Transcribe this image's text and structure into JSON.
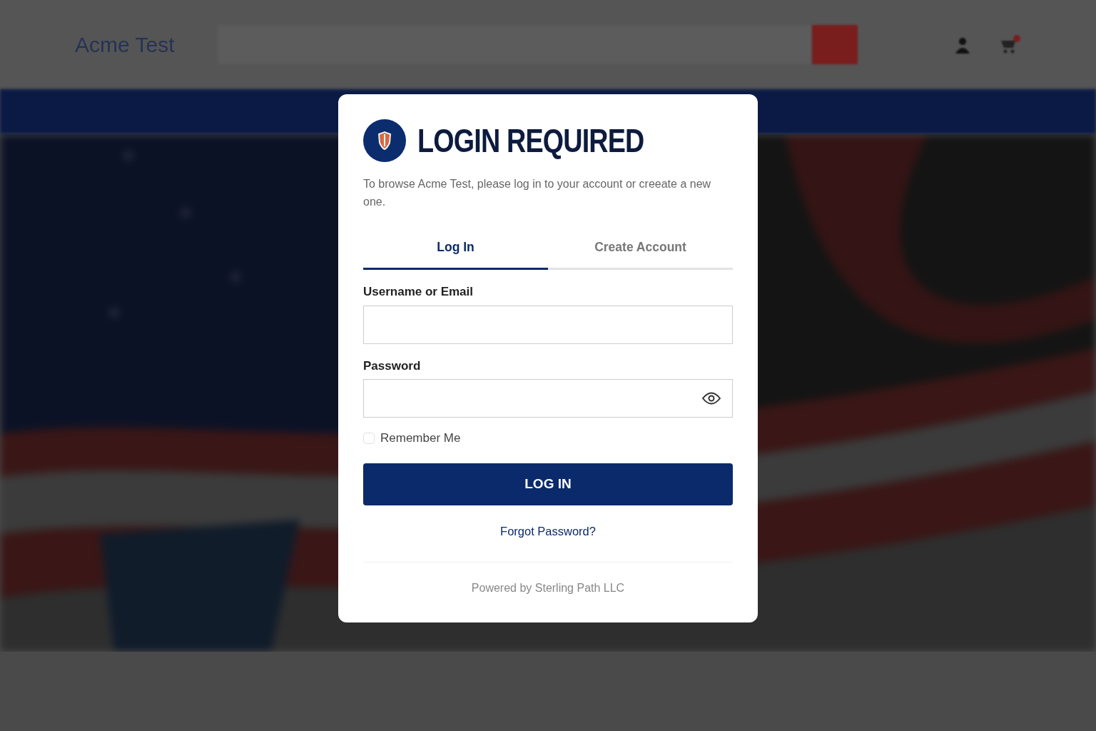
{
  "background": {
    "logo": "Acme Test"
  },
  "dialog": {
    "title": "LOGIN REQUIRED",
    "message": "To browse Acme Test, please log in to your account or creeate a new one.",
    "tabs": [
      {
        "label": "Log In",
        "selected": true
      },
      {
        "label": "Create Account",
        "selected": false
      }
    ],
    "fields": [
      {
        "label": "Username or Email",
        "kind": "text"
      },
      {
        "label": "Password",
        "kind": "password"
      }
    ],
    "remember": {
      "label": "Remember Me",
      "checked": false
    },
    "submit": "LOG IN",
    "forgot": "Forgot Password?",
    "footer": "Powered by Sterling Path LLC"
  }
}
